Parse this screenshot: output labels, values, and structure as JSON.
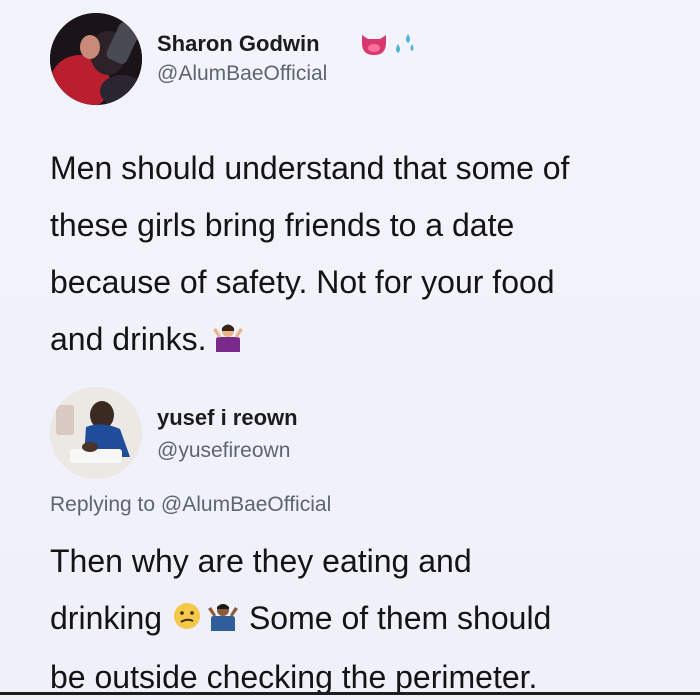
{
  "tweet": {
    "author": {
      "display_name": "Sharon Godwin",
      "handle": "@AlumBaeOfficial",
      "badges": [
        "tongue-face-icon",
        "droplets-icon"
      ]
    },
    "text_lines": [
      "Men should understand that some of",
      "these girls bring friends to a date",
      "because of safety. Not for your food",
      "and drinks."
    ],
    "text_emoji": "person-shrugging-icon"
  },
  "reply": {
    "author": {
      "display_name": "yusef i reown",
      "handle": "@yusefireown"
    },
    "replying_to_label": "Replying to",
    "replying_to_handle": "@AlumBaeOfficial",
    "text_line_1": "Then why are they eating and",
    "text_line_2_before": "drinking",
    "text_line_2_after": "Some of them should",
    "text_line_3": "be outside checking the perimeter.",
    "emojis": [
      "confused-face-icon",
      "person-shrugging-icon"
    ]
  },
  "colors": {
    "background": "#f1f2fa",
    "text_primary": "#141414",
    "text_secondary": "#5d6570",
    "badge_pink": "#d9386e",
    "shrug_purple": "#7a2a8a",
    "emoji_yellow": "#f5c84a"
  }
}
